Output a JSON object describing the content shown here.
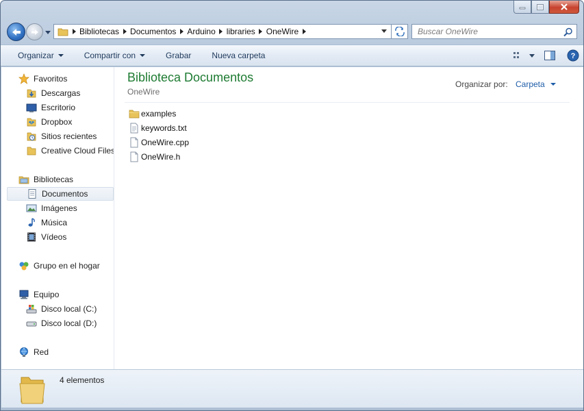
{
  "window": {
    "caption_buttons": [
      "minimize",
      "maximize",
      "close"
    ]
  },
  "navigation": {
    "back_icon": "arrow-left-icon",
    "forward_icon": "arrow-right-icon"
  },
  "address_bar": {
    "breadcrumbs": [
      "Bibliotecas",
      "Documentos",
      "Arduino",
      "libraries",
      "OneWire"
    ]
  },
  "search": {
    "placeholder": "Buscar OneWire"
  },
  "toolbar": {
    "organize": "Organizar",
    "share": "Compartir con",
    "burn": "Grabar",
    "new_folder": "Nueva carpeta"
  },
  "sidebar": {
    "favorites": {
      "label": "Favoritos",
      "items": [
        "Descargas",
        "Escritorio",
        "Dropbox",
        "Sitios recientes",
        "Creative Cloud Files"
      ]
    },
    "libraries": {
      "label": "Bibliotecas",
      "items": [
        "Documentos",
        "Imágenes",
        "Música",
        "Vídeos"
      ],
      "selected": "Documentos"
    },
    "homegroup": {
      "label": "Grupo en el hogar"
    },
    "computer": {
      "label": "Equipo",
      "items": [
        "Disco local (C:)",
        "Disco local (D:)"
      ]
    },
    "network": {
      "label": "Red"
    }
  },
  "main": {
    "title": "Biblioteca Documentos",
    "subtitle": "OneWire",
    "arrange_label": "Organizar por:",
    "arrange_value": "Carpeta",
    "files": [
      {
        "name": "examples",
        "icon": "folder-icon"
      },
      {
        "name": "keywords.txt",
        "icon": "text-file-icon"
      },
      {
        "name": "OneWire.cpp",
        "icon": "file-icon"
      },
      {
        "name": "OneWire.h",
        "icon": "file-icon"
      }
    ]
  },
  "details": {
    "count": "4 elementos"
  },
  "colors": {
    "title_green": "#1e7b32",
    "link_blue": "#1e5da8",
    "toolbar_text": "#1e395b"
  }
}
